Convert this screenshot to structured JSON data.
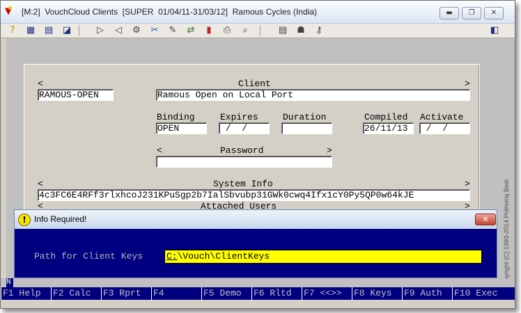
{
  "window": {
    "title": "[M:2]  VouchCloud Clients  [SUPER  01/04/11-31/03/12]  Ramous Cycles (India)",
    "minimize_label": "▬",
    "maximize_label": "❐",
    "close_label": "✕"
  },
  "toolbar": {
    "icons": [
      "help-icon",
      "grid-icon",
      "calculator-icon",
      "report-icon",
      "play-icon",
      "back-icon",
      "settings-icon",
      "tools-icon",
      "edit-icon",
      "transfer-icon",
      "chart-icon",
      "print-icon",
      "search-icon",
      "document-icon",
      "users-icon",
      "key-icon",
      "exit-icon"
    ]
  },
  "form": {
    "client_code_arrow": "<",
    "client_header": "Client",
    "client_header_right_arrow": ">",
    "client_code": "RAMOUS-OPEN",
    "client_name": "Ramous Open on Local Port",
    "binding_label": "Binding",
    "binding_value": "OPEN",
    "expires_label": "Expires",
    "expires_value": " /  /",
    "duration_label": "Duration",
    "duration_value": "",
    "compiled_label": "Compiled",
    "compiled_value": "26/11/13",
    "activate_label": "Activate",
    "activate_value": " /  /",
    "password_left_arrow": "<",
    "password_label": "Password",
    "password_right_arrow": ">",
    "password_value": "",
    "sysinfo_left_arrow": "<",
    "sysinfo_label": "System Info",
    "sysinfo_right_arrow": ">",
    "sysinfo_value": "4c3FC6E4RFf3rlxhcoJ231KPuSgp2b7IalSbvubp31GWk0cwq4Ifx1cY0Py5QP0w64kJE",
    "attached_left_arrow": "<",
    "attached_label": "Attached Users",
    "attached_right_arrow": ">"
  },
  "dialog": {
    "title": "Info Required!",
    "close_label": "✕",
    "prompt": "Path for Client Keys",
    "input_first_char": "C:",
    "input_rest": "\\Vouch\\ClientKeys"
  },
  "copyright": "Copyright  (C)  1993-2014  Prithviraj Bedi",
  "status": {
    "indicator": "N"
  },
  "fkeys": [
    "F1 Help",
    "F2 Calc",
    "F3 Rprt",
    "F4",
    "F5 Demo",
    "F6 Rltd",
    "F7 <<>>",
    "F8 Keys",
    "F9 Auth",
    "F10 Exec"
  ]
}
